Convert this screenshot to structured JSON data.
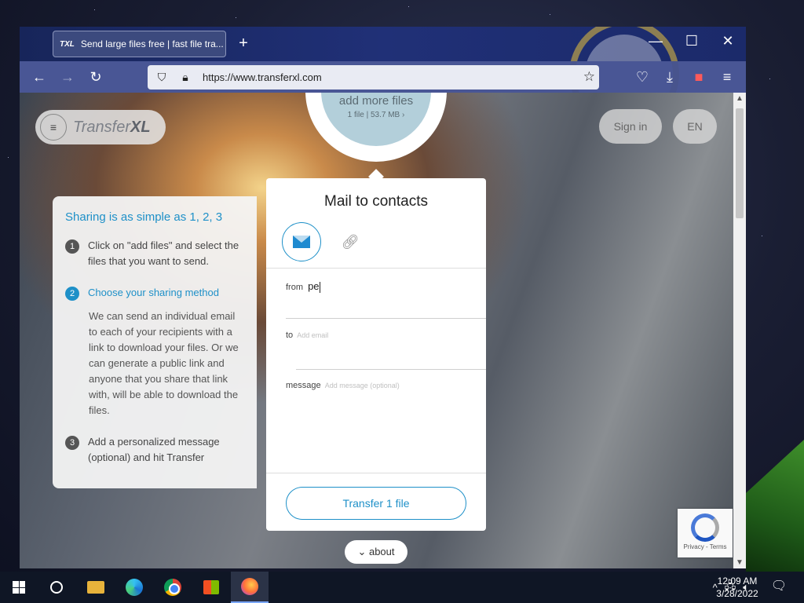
{
  "browser": {
    "tab_title": "Send large files free | fast file tra...",
    "tab_favicon_text": "TXL",
    "new_tab_label": "+",
    "url": "https://www.transferxl.com",
    "window_controls": {
      "minimize": "—",
      "maximize": "☐",
      "close": "✕"
    },
    "nav": {
      "back": "←",
      "forward": "→",
      "reload": "↻"
    },
    "icons": [
      "shield-icon",
      "lock-icon",
      "bookmark-star-icon",
      "pocket-icon",
      "download-icon",
      "extension-icon",
      "menu-icon"
    ],
    "extension_badge": "1"
  },
  "site": {
    "logo_text_a": "Transfer",
    "logo_text_b": "XL",
    "sign_in": "Sign in",
    "language": "EN",
    "upload": {
      "label": "add more files",
      "file_info": "1 file | 53.7 MB ›"
    },
    "steps": {
      "heading": "Sharing is as simple as 1, 2, 3",
      "items": [
        {
          "num": "1",
          "text": "Click on \"add files\" and select the files that you want to send."
        },
        {
          "num": "2",
          "text": "Choose your sharing method",
          "desc": "We can send an individual email to each of your recipients with a link to download your files. Or we can generate a public link and anyone that you share that link with, will be able to download the files."
        },
        {
          "num": "3",
          "text": "Add a personalized message (optional) and hit Transfer"
        }
      ]
    },
    "card": {
      "title": "Mail to contacts",
      "from_label": "from",
      "from_value": "pe",
      "to_label": "to",
      "to_placeholder": "Add email",
      "message_label": "message",
      "message_placeholder": "Add message (optional)",
      "transfer_button": "Transfer 1 file"
    },
    "about": "⌄ about",
    "recaptcha": "Privacy - Terms"
  },
  "taskbar": {
    "time": "12:09 AM",
    "date": "3/28/2022"
  },
  "colors": {
    "accent": "#1e90c8",
    "tab_bar": "#1f2e6e"
  }
}
